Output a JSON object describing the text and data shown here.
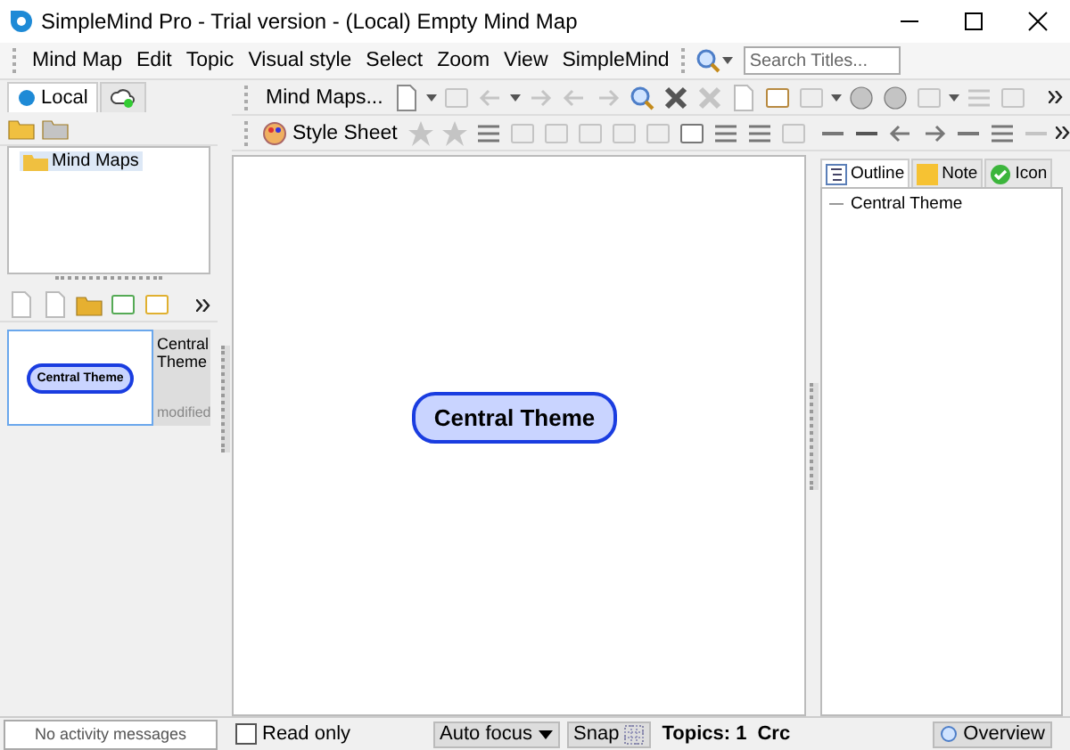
{
  "window": {
    "title": "SimpleMind Pro - Trial version - (Local) Empty Mind Map"
  },
  "menu": [
    "Mind Map",
    "Edit",
    "Topic",
    "Visual style",
    "Select",
    "Zoom",
    "View",
    "SimpleMind"
  ],
  "search": {
    "placeholder": "Search Titles..."
  },
  "left_tabs": [
    {
      "label": "Local",
      "selected": true
    },
    {
      "kind": "cloud",
      "selected": false
    }
  ],
  "tree": [
    {
      "label": "Mind Maps",
      "selected": true
    }
  ],
  "thumbnail": {
    "node": "Central Theme",
    "title": "Central Theme",
    "status": "modified",
    "selected": true
  },
  "toolbar1": {
    "button": "Mind Maps..."
  },
  "toolbar2": {
    "button": "Style Sheet"
  },
  "canvas": {
    "node": "Central Theme"
  },
  "right_tabs": [
    {
      "label": "Outline",
      "selected": true
    },
    {
      "label": "Note",
      "selected": false
    },
    {
      "label": "Icon",
      "selected": false
    }
  ],
  "outline": [
    {
      "label": "Central Theme"
    }
  ],
  "status": {
    "activity": "No activity messages",
    "read_only": {
      "label": "Read only",
      "checked": false
    },
    "auto_focus": "Auto focus",
    "snap": "Snap",
    "topics": "Topics: 1",
    "crc": "Crc",
    "overview": "Overview"
  }
}
